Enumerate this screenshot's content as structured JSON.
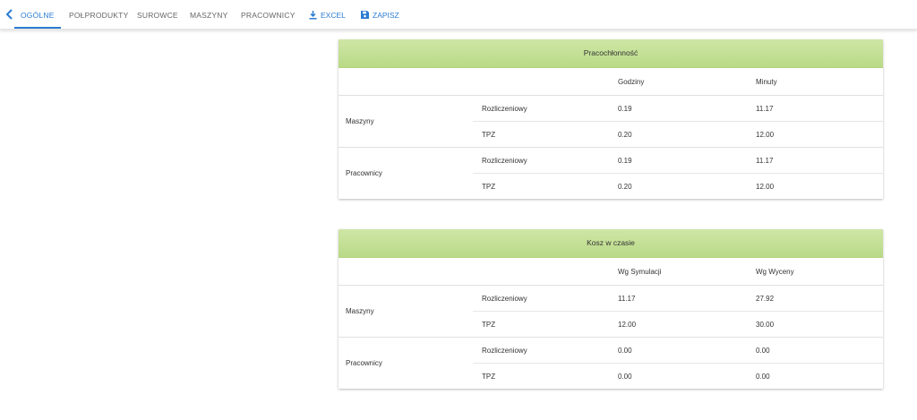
{
  "tabs": [
    {
      "label": "OGÓLNE",
      "active": true
    },
    {
      "label": "POŁPRODUKTY",
      "active": false
    },
    {
      "label": "SUROWCE",
      "active": false
    },
    {
      "label": "MASZYNY",
      "active": false
    },
    {
      "label": "PRACOWNICY",
      "active": false
    }
  ],
  "actions": {
    "excel": {
      "label": "EXCEL",
      "icon": "download-icon"
    },
    "save": {
      "label": "ZAPISZ",
      "icon": "save-icon"
    }
  },
  "accent_color": "#2b7bd1",
  "header_color": "#c5e09a",
  "pracochlonnosc": {
    "title": "Pracochłonność",
    "col1": "Godziny",
    "col2": "Minuty",
    "groups": [
      {
        "label": "Maszyny",
        "rows": [
          {
            "type": "Rozliczeniowy",
            "v1": "0.19",
            "v2": "11.17"
          },
          {
            "type": "TPZ",
            "v1": "0.20",
            "v2": "12.00"
          }
        ]
      },
      {
        "label": "Pracownicy",
        "rows": [
          {
            "type": "Rozliczeniowy",
            "v1": "0.19",
            "v2": "11.17"
          },
          {
            "type": "TPZ",
            "v1": "0.20",
            "v2": "12.00"
          }
        ]
      }
    ]
  },
  "koszt": {
    "title": "Kosz w czasie",
    "col1": "Wg Symulacji",
    "col2": "Wg Wyceny",
    "groups": [
      {
        "label": "Maszyny",
        "rows": [
          {
            "type": "Rozliczeniowy",
            "v1": "11.17",
            "v2": "27.92"
          },
          {
            "type": "TPZ",
            "v1": "12.00",
            "v2": "30.00"
          }
        ]
      },
      {
        "label": "Pracownicy",
        "rows": [
          {
            "type": "Rozliczeniowy",
            "v1": "0.00",
            "v2": "0.00"
          },
          {
            "type": "TPZ",
            "v1": "0.00",
            "v2": "0.00"
          }
        ]
      }
    ]
  }
}
